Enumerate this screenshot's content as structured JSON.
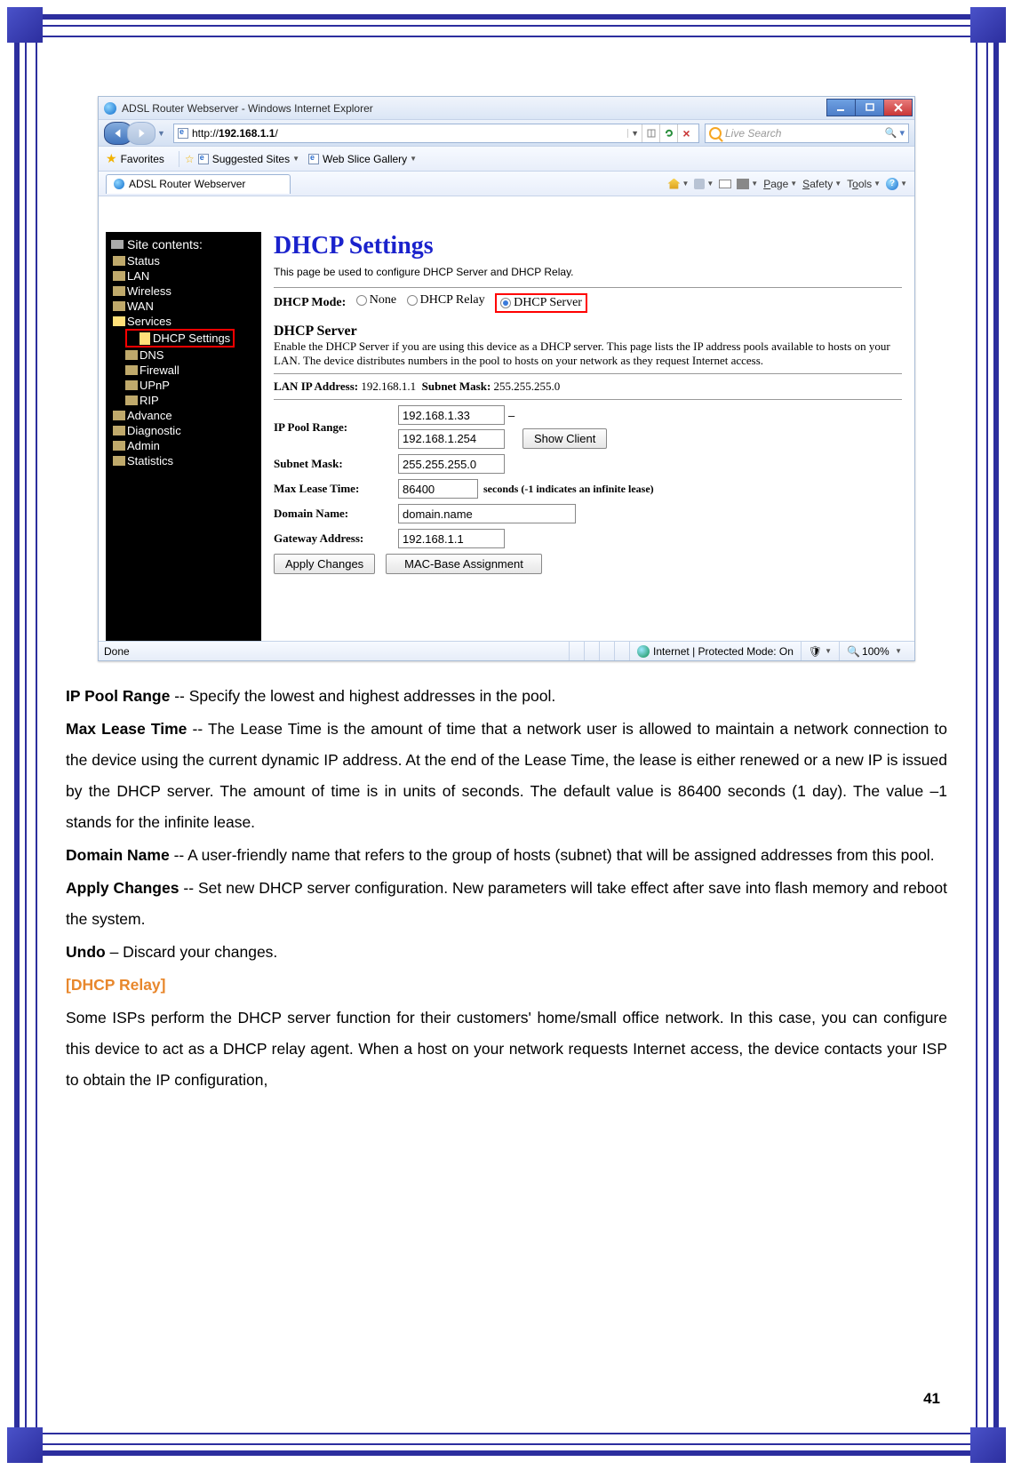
{
  "browser": {
    "window_title": "ADSL Router Webserver - Windows Internet Explorer",
    "url_prefix": "http://",
    "url_bold": "192.168.1.1",
    "url_suffix": "/",
    "search_placeholder": "Live Search",
    "favorites_label": "Favorites",
    "suggested_sites": "Suggested Sites",
    "web_slice": "Web Slice Gallery",
    "tab_title": "ADSL Router Webserver",
    "tools": {
      "page": "Page",
      "safety": "Safety",
      "tools": "Tools"
    },
    "status_left": "Done",
    "status_zone": "Internet | Protected Mode: On",
    "zoom": "100%"
  },
  "sidebar": {
    "title": "Site contents:",
    "items": {
      "status": "Status",
      "lan": "LAN",
      "wireless": "Wireless",
      "wan": "WAN",
      "services": "Services",
      "dhcp": "DHCP Settings",
      "dns": "DNS",
      "firewall": "Firewall",
      "upnp": "UPnP",
      "rip": "RIP",
      "advance": "Advance",
      "diagnostic": "Diagnostic",
      "admin": "Admin",
      "statistics": "Statistics"
    }
  },
  "page": {
    "title": "DHCP Settings",
    "desc": "This page be used to configure DHCP Server and DHCP Relay.",
    "mode_label": "DHCP Mode:",
    "mode_opts": {
      "none": "None",
      "relay": "DHCP Relay",
      "server": "DHCP Server"
    },
    "server_h": "DHCP Server",
    "server_p": "Enable the DHCP Server if you are using this device as a DHCP server. This page lists the IP address pools available to hosts on your LAN. The device distributes numbers in the pool to hosts on your network as they request Internet access.",
    "lan_label": "LAN IP Address:",
    "lan_val": "192.168.1.1",
    "sm_label": "Subnet Mask:",
    "sm_val": "255.255.255.0",
    "labels": {
      "pool": "IP Pool Range:",
      "subnet": "Subnet Mask:",
      "lease": "Max Lease Time:",
      "domain": "Domain Name:",
      "gateway": "Gateway Address:"
    },
    "inputs": {
      "pool_lo": "192.168.1.33",
      "pool_hi": "192.168.1.254",
      "subnet": "255.255.255.0",
      "lease": "86400",
      "domain": "domain.name",
      "gateway": "192.168.1.1"
    },
    "buttons": {
      "show_client": "Show Client",
      "apply": "Apply Changes",
      "mac": "MAC-Base Assignment"
    },
    "lease_hint": "seconds (-1 indicates an infinite lease)"
  },
  "doc": {
    "p1_b": "IP Pool Range",
    "p1": " -- Specify the lowest and highest addresses in the pool.",
    "p2_b": "Max Lease Time",
    "p2": " -- The Lease Time is the amount of time that a network user is allowed to maintain a network connection to the device using the current dynamic IP address. At the end of the Lease Time, the lease is either renewed or a new IP is issued by the DHCP server. The amount of time is in units of seconds. The default value is 86400 seconds (1 day). The value –1 stands for the infinite lease.",
    "p3_b": "Domain Name",
    "p3": " -- A user-friendly name that refers to the group of hosts (subnet) that will be assigned addresses from this pool.",
    "p4_b": "Apply Changes",
    "p4": " -- Set new DHCP server configuration. New parameters will take effect after save into flash memory and reboot the system.",
    "p5_b": "Undo",
    "p5": " – Discard your changes.",
    "hd": "[DHCP Relay]",
    "p6": "Some ISPs perform the DHCP server function for their customers' home/small office network. In this case, you can configure this device to act as a DHCP relay agent. When a host on your network requests Internet access, the device contacts your ISP to obtain the IP configuration,"
  },
  "pagenum": "41"
}
